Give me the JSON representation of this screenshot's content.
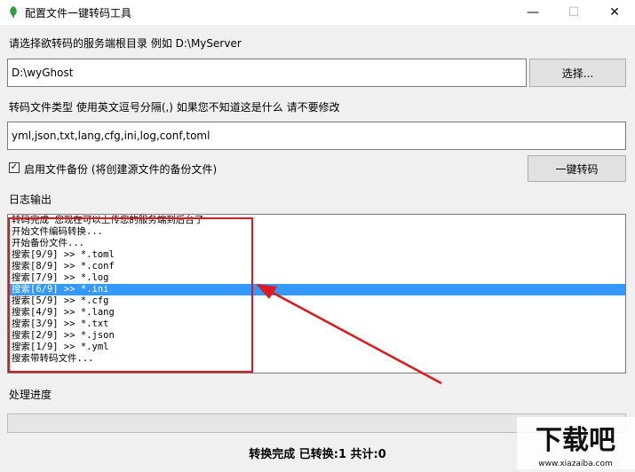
{
  "window": {
    "title": "配置文件一键转码工具",
    "controls": {
      "minimize": "—",
      "maximize": "☐",
      "close": "✕"
    }
  },
  "server_dir": {
    "label": "请选择欲转码的服务端根目录 例如 D:\\MyServer",
    "value": "D:\\wyGhost",
    "browse_label": "选择..."
  },
  "file_types": {
    "label": "转码文件类型 使用英文逗号分隔(,) 如果您不知道这是什么 请不要修改",
    "value": "yml,json,txt,lang,cfg,ini,log,conf,toml"
  },
  "backup": {
    "checked": true,
    "label": "启用文件备份 (将创建源文件的备份文件)"
  },
  "convert_button": "一键转码",
  "log": {
    "label": "日志输出",
    "lines": [
      "转码完成 您现在可以上传您的服务端到后台了",
      "开始文件编码转换...",
      "开始备份文件...",
      "搜索[9/9] >> *.toml",
      "搜索[8/9] >> *.conf",
      "搜索[7/9] >> *.log",
      "搜索[6/9] >> *.ini",
      "搜索[5/9] >> *.cfg",
      "搜索[4/9] >> *.lang",
      "搜索[3/9] >> *.txt",
      "搜索[2/9] >> *.json",
      "搜索[1/9] >> *.yml",
      "搜索带转码文件..."
    ],
    "selected_index": 6
  },
  "progress": {
    "label": "处理进度",
    "value": 0
  },
  "status": "转换完成 已转换:1 共计:0",
  "colors": {
    "annotation": "#e0181c",
    "selection": "#3399ff"
  },
  "watermark": "下载吧"
}
